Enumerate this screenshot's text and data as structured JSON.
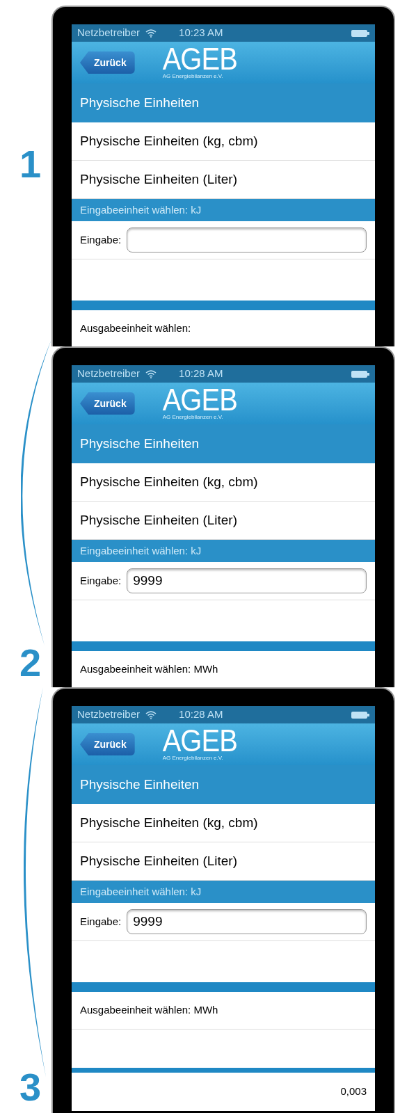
{
  "steps": [
    {
      "number": "1",
      "screen": {
        "status": {
          "carrier": "Netzbetreiber",
          "time": "10:23 AM"
        },
        "back_button": "Zurück",
        "logo": {
          "title": "AGEB",
          "subtitle": "AG Energiebilanzen e.V."
        },
        "section_header": "Physische Einheiten",
        "items": [
          "Physische Einheiten (kg, cbm)",
          "Physische Einheiten (Liter)"
        ],
        "input_header": "Eingabeeinheit wählen: kJ",
        "input": {
          "label": "Eingabe:"
        },
        "output_label": "Ausgabeeinheit wählen:"
      }
    },
    {
      "number": "2",
      "screen": {
        "status": {
          "carrier": "Netzbetreiber",
          "time": "10:28 AM"
        },
        "back_button": "Zurück",
        "logo": {
          "title": "AGEB",
          "subtitle": "AG Energiebilanzen e.V."
        },
        "section_header": "Physische Einheiten",
        "items": [
          "Physische Einheiten (kg, cbm)",
          "Physische Einheiten (Liter)"
        ],
        "input_header": "Eingabeeinheit wählen: kJ",
        "input": {
          "label": "Eingabe:",
          "value": "9999"
        },
        "output_label": "Ausgabeeinheit wählen: MWh"
      }
    },
    {
      "number": "3",
      "screen": {
        "status": {
          "carrier": "Netzbetreiber",
          "time": "10:28 AM"
        },
        "back_button": "Zurück",
        "logo": {
          "title": "AGEB",
          "subtitle": "AG Energiebilanzen e.V."
        },
        "section_header": "Physische Einheiten",
        "items": [
          "Physische Einheiten (kg, cbm)",
          "Physische Einheiten (Liter)"
        ],
        "input_header": "Eingabeeinheit wählen: kJ",
        "input": {
          "label": "Eingabe:",
          "value": "9999"
        },
        "output_label": "Ausgabeeinheit wählen: MWh",
        "result": "0,003"
      }
    }
  ]
}
